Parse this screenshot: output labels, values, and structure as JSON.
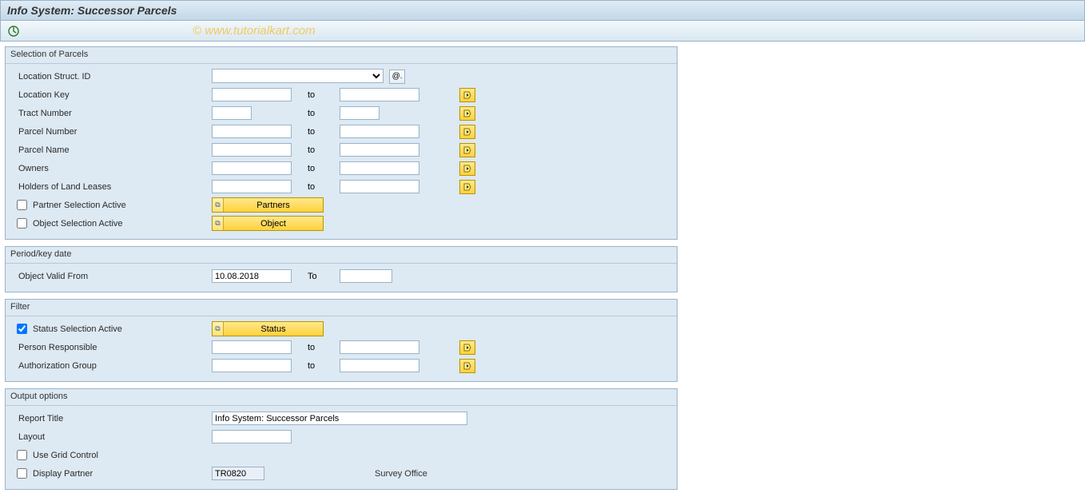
{
  "title": "Info System: Successor Parcels",
  "watermark": "© www.tutorialkart.com",
  "groups": {
    "parcels": {
      "title": "Selection of Parcels",
      "location_struct_id": "Location Struct. ID",
      "location_key": "Location Key",
      "tract_number": "Tract Number",
      "parcel_number": "Parcel Number",
      "parcel_name": "Parcel Name",
      "owners": "Owners",
      "holders": "Holders of Land Leases",
      "partner_sel": "Partner Selection Active",
      "object_sel": "Object Selection Active",
      "to": "to",
      "partners_btn": "Partners",
      "object_btn": "Object"
    },
    "period": {
      "title": "Period/key date",
      "valid_from": "Object Valid From",
      "to": "To",
      "from_value": "10.08.2018"
    },
    "filter": {
      "title": "Filter",
      "status_sel": "Status Selection Active",
      "status_btn": "Status",
      "person": "Person Responsible",
      "auth": "Authorization Group",
      "to": "to"
    },
    "output": {
      "title": "Output options",
      "report_title": "Report Title",
      "report_title_val": "Info System: Successor Parcels",
      "layout": "Layout",
      "grid": "Use Grid Control",
      "disp_partner": "Display Partner",
      "disp_partner_val": "TR0820",
      "survey": "Survey Office"
    }
  }
}
